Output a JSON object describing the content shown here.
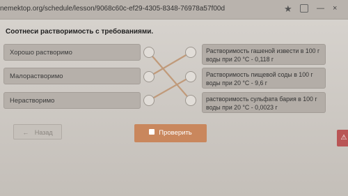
{
  "browser": {
    "url": "nemektop.org/schedule/lesson/9068c60c-ef29-4305-8348-76978a57f00d",
    "star_glyph": "★",
    "ext_glyph": "",
    "minimize_glyph": "—",
    "close_glyph": "×"
  },
  "task": {
    "title": "Соотнеси растворимость с требованиями."
  },
  "left_items": [
    {
      "label": "Хорошо растворимо"
    },
    {
      "label": "Малорастворимо"
    },
    {
      "label": "Нерастворимо"
    }
  ],
  "right_items": [
    {
      "line1": "Растворимость гашеной извести в 100 г",
      "line2": "воды при 20 °С - 0,118 г"
    },
    {
      "line1": "Растворимость пищевой соды в 100 г",
      "line2": "воды при 20 °С - 9,6 г"
    },
    {
      "line1": "растворимость сульфата бария в 100 г",
      "line2": "воды при 20 °С - 0,0023 г"
    }
  ],
  "connections": [
    {
      "from": "Хорошо растворимо",
      "to": "растворимость сульфата бария в 100 г"
    },
    {
      "from": "Малорастворимо",
      "to": "Растворимость гашеной извести в 100 г"
    },
    {
      "from": "Нерастворимо",
      "to": "Растворимость пищевой соды в 100 г"
    }
  ],
  "buttons": {
    "back_label": "Назад",
    "back_icon": "←",
    "check_label": "Проверить"
  },
  "side_badge": "⚠",
  "colors": {
    "accent": "#c9875d",
    "line": "#c09a7a"
  }
}
